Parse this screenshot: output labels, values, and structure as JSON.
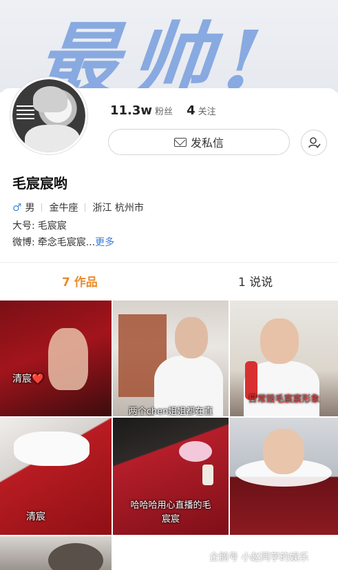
{
  "banner": {
    "text": "最帅!"
  },
  "profile": {
    "followers_count": "11.3w",
    "followers_label": "粉丝",
    "following_count": "4",
    "following_label": "关注",
    "message_button": "发私信",
    "nickname": "毛宸宸哟",
    "gender": "男",
    "zodiac": "金牛座",
    "location": "浙江 杭州市",
    "alias_label": "大号:",
    "alias_value": "毛宸宸",
    "weibo_label": "微博:",
    "weibo_value": "牵念毛宸宸...",
    "more_link": "更多"
  },
  "tabs": [
    {
      "label": "7 作品",
      "active": true
    },
    {
      "label": "1 说说",
      "active": false
    }
  ],
  "posts": [
    {
      "caption": "清宸❤️"
    },
    {
      "caption": "两个chen姐姐都在直"
    },
    {
      "caption": "日常毁毛宸宸形象"
    },
    {
      "caption": "清宸"
    },
    {
      "caption": "哈哈哈用心直播的毛宸宸"
    },
    {
      "caption": ""
    },
    {
      "caption": ""
    }
  ],
  "watermark": {
    "text": "企鹅号 小赵同学的娱乐"
  },
  "colors": {
    "accent": "#ea8a2c",
    "link": "#3a7bd5",
    "gender": "#3a8ee6"
  }
}
